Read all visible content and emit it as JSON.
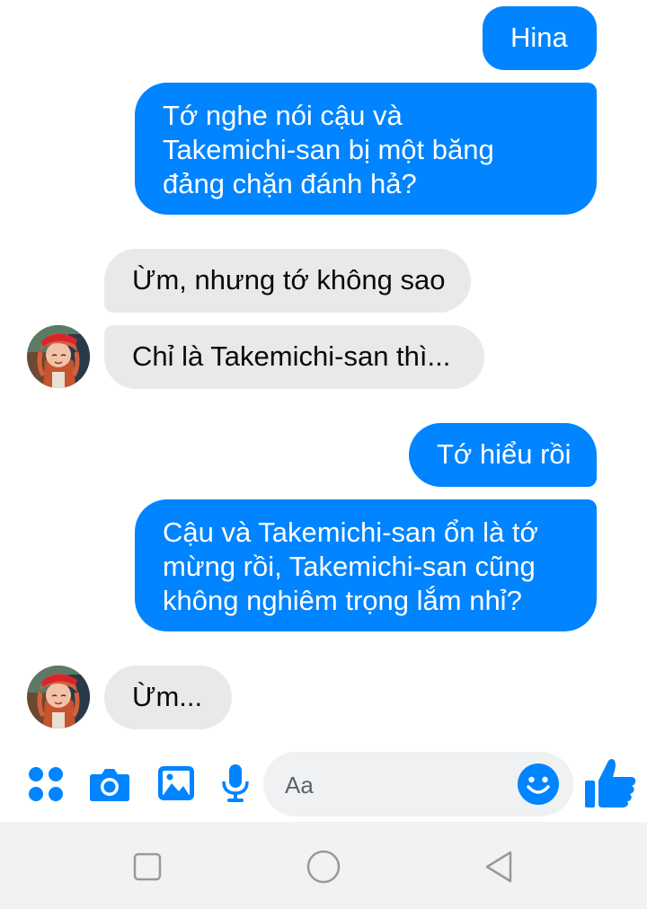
{
  "messages": [
    {
      "sender": "me",
      "text": "Hina"
    },
    {
      "sender": "me",
      "text": "Tớ nghe nói cậu và\nTakemichi-san bị một băng\nđảng chặn đánh hả?"
    },
    {
      "sender": "contact",
      "text": "Ừm, nhưng tớ không sao"
    },
    {
      "sender": "contact",
      "text": "Chỉ là Takemichi-san thì..."
    },
    {
      "sender": "me",
      "text": "Tớ hiểu rồi"
    },
    {
      "sender": "me",
      "text": "Cậu và Takemichi-san ổn là tớ\nmừng rồi, Takemichi-san cũng\nkhông nghiêm trọng lắm nhỉ?"
    },
    {
      "sender": "contact",
      "text": "Ừm..."
    }
  ],
  "composer": {
    "placeholder": "Aa",
    "icons": [
      "apps-icon",
      "camera-icon",
      "gallery-icon",
      "microphone-icon",
      "emoji-icon",
      "thumbs-up-icon"
    ]
  },
  "navigation": {
    "icons": [
      "recent-apps-icon",
      "home-icon",
      "back-icon"
    ]
  },
  "colors": {
    "accent": "#0084ff",
    "incoming_bubble": "#e9e9eb",
    "field_background": "#f0f1f3",
    "nav_background": "#f2f2f2"
  }
}
